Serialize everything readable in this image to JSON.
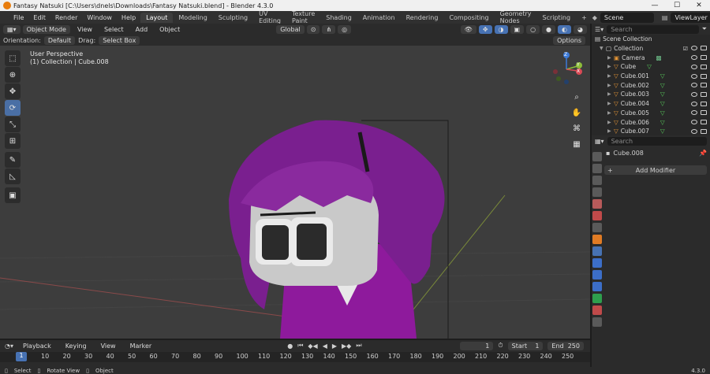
{
  "window": {
    "title": "Fantasy Natsuki [C:\\Users\\dnels\\Downloads\\Fantasy Natsuki.blend] - Blender 4.3.0",
    "controls": [
      "—",
      "☐",
      "✕"
    ]
  },
  "menubar": {
    "menus": [
      "File",
      "Edit",
      "Render",
      "Window",
      "Help"
    ],
    "workspaces": [
      "Layout",
      "Modeling",
      "Sculpting",
      "UV Editing",
      "Texture Paint",
      "Shading",
      "Animation",
      "Rendering",
      "Compositing",
      "Geometry Nodes",
      "Scripting"
    ],
    "add_workspace": "+",
    "scene_label": "Scene",
    "viewlayer_label": "ViewLayer"
  },
  "viewport_header": {
    "mode": "Object Mode",
    "menus": [
      "View",
      "Select",
      "Add",
      "Object"
    ],
    "transform_orientation": "Global",
    "options_label": "Options",
    "orientation_label": "Orientation:",
    "orientation_value": "Default",
    "drag_label": "Drag:",
    "drag_value": "Select Box"
  },
  "viewport": {
    "perspective_text": "User Perspective",
    "collection_text": "(1) Collection | Cube.008",
    "gizmo_axes": [
      "Z",
      "Y",
      "X"
    ],
    "colors": {
      "background": "#3d3d3d",
      "hair": "#7a1f8f",
      "face": "#c9c9c9",
      "body": "#8e1a9c"
    }
  },
  "tools": [
    "select-box",
    "cursor",
    "move",
    "rotate",
    "scale",
    "transform",
    "annotate",
    "measure",
    "add-cube"
  ],
  "outliner": {
    "search_placeholder": "Search",
    "scene_collection": "Scene Collection",
    "collection": "Collection",
    "items": [
      "Camera",
      "Cube",
      "Cube.001",
      "Cube.002",
      "Cube.003",
      "Cube.004",
      "Cube.005",
      "Cube.006",
      "Cube.007"
    ]
  },
  "properties": {
    "search_placeholder": "Search",
    "object_name": "Cube.008",
    "add_modifier": "Add Modifier"
  },
  "timeline": {
    "menus": [
      "Playback",
      "Keying",
      "View",
      "Marker"
    ],
    "current_frame": "1",
    "start_label": "Start",
    "start": "1",
    "end_label": "End",
    "end": "250",
    "ruler": [
      "1",
      "10",
      "20",
      "30",
      "40",
      "50",
      "60",
      "70",
      "80",
      "90",
      "100",
      "110",
      "120",
      "130",
      "140",
      "150",
      "160",
      "170",
      "180",
      "190",
      "200",
      "210",
      "220",
      "230",
      "240",
      "250"
    ]
  },
  "statusbar": {
    "items": [
      "Select",
      "Rotate View",
      "Object"
    ],
    "version": "4.3.0"
  }
}
